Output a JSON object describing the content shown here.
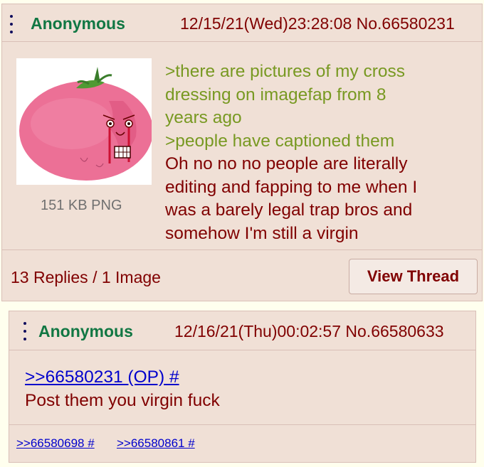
{
  "op": {
    "name": "Anonymous",
    "datetime": "12/15/21(Wed)23:28:08 No.66580231",
    "file_info": "151 KB PNG",
    "thumbnail_icon": "crying-tomato-wojak-image",
    "lines": [
      {
        "text": ">there are pictures of my cross",
        "type": "quote"
      },
      {
        "text": "dressing on imagefap from 8",
        "type": "quote"
      },
      {
        "text": "years ago",
        "type": "quote"
      },
      {
        "text": ">people have captioned them",
        "type": "quote"
      },
      {
        "text": "Oh no no no people are literally",
        "type": "text"
      },
      {
        "text": "editing and fapping to me when I",
        "type": "text"
      },
      {
        "text": "was a barely legal trap bros and",
        "type": "text"
      },
      {
        "text": "somehow I'm still a virgin",
        "type": "text"
      }
    ],
    "replies_summary": "13 Replies / 1 Image",
    "view_thread_label": "View Thread"
  },
  "reply": {
    "name": "Anonymous",
    "datetime": "12/16/21(Thu)00:02:57 No.66580633",
    "quote_link": ">>66580231 (OP) #",
    "body": "Post them you virgin fuck",
    "backlinks": [
      ">>66580698 #",
      ">>66580861 #"
    ]
  },
  "colors": {
    "background": "#ffffee",
    "post_bg": "#f0e0d6",
    "name": "#117743",
    "greentext": "#789922",
    "text": "#800000",
    "link": "#0000cc"
  }
}
